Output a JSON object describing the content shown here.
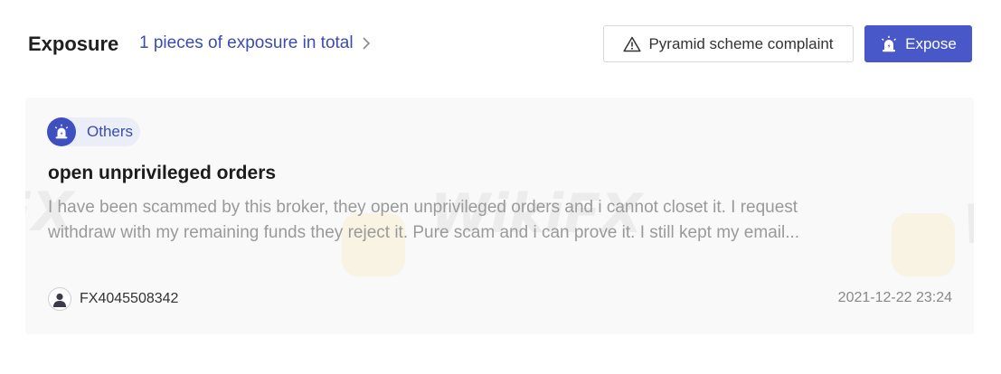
{
  "header": {
    "title": "Exposure",
    "count_link": "1 pieces of exposure in total",
    "complaint_button": "Pyramid scheme complaint",
    "expose_button": "Expose"
  },
  "post": {
    "category": "Others",
    "title": "open unprivileged orders",
    "body_line_1": "I have been scammed by this broker, they open unprivileged orders and i cannot closet it. I request",
    "body_line_2": "withdraw with my remaining funds they reject it. Pure scam and i can prove it. I still kept my email...",
    "author": "FX4045508342",
    "date": "2021-12-22 23:24"
  },
  "watermarks": [
    "FX",
    "WikiFX",
    "W"
  ],
  "colors": {
    "accent": "#4858c8",
    "link": "#3b4cb0",
    "card_bg": "#f9f9f9",
    "tag_bg": "#ebeef6"
  },
  "icons": {
    "complaint": "warning-triangle-icon",
    "expose": "alarm-siren-icon",
    "link": "chevron-right-icon",
    "avatar": "user-icon"
  }
}
